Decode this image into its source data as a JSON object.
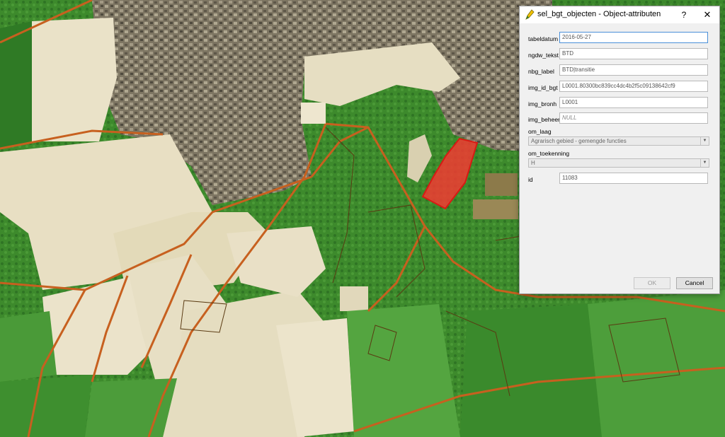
{
  "dialog": {
    "title": "sel_bgt_objecten - Object-attributen",
    "help_label": "?",
    "close_label": "✕",
    "ok_label": "OK",
    "cancel_label": "Cancel"
  },
  "fields": [
    {
      "label": "tabeldatum",
      "value": "2016-05-27"
    },
    {
      "label": "ngdw_tekst",
      "value": "BTD"
    },
    {
      "label": "nbg_label",
      "value": "BTD|transitie"
    },
    {
      "label": "img_id_bgt",
      "value": "L0001.80300bc839cc4dc4b2f5c09138642cf9"
    },
    {
      "label": "img_bronh",
      "value": "L0001"
    },
    {
      "label": "img_beheer",
      "value": "NULL"
    }
  ],
  "combos": [
    {
      "label": "om_laag",
      "value": "Agrarisch gebied - gemengde functies"
    },
    {
      "label": "om_toekenning",
      "value": "H"
    }
  ],
  "id_field": {
    "label": "id",
    "value": "11083"
  },
  "colors": {
    "selection": "#f23a32",
    "road": "#c7601f",
    "forest": "#3f8a2e",
    "agri": "#e9e1c8",
    "urban": "#7c7360"
  },
  "icons": {
    "title": "pencil-icon",
    "dropdown": "chevron-down-icon"
  }
}
